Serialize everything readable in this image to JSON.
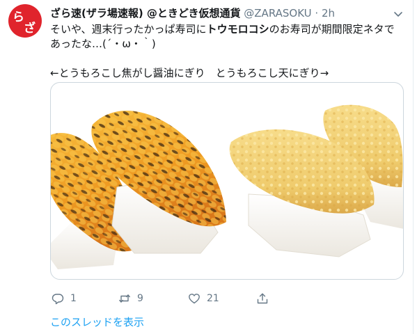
{
  "author": {
    "avatar_text_1": "ら",
    "avatar_text_2": "ざ",
    "display_name": "ざら速(ザラ場速報) @ときどき仮想通貨",
    "handle": "@ZARASOKU",
    "separator": "·",
    "time": "2h"
  },
  "tweet": {
    "line1_pre": "そいや、週末行ったかっぱ寿司に",
    "line1_bold": "トウモロコシ",
    "line1_post": "のお寿司が期間限定ネタで",
    "line2": "あったな…(´・ω・｀)",
    "line3": "←とうもろこし焦がし醤油にぎり　とうもろこし天にぎり→"
  },
  "actions": {
    "reply_count": "1",
    "retweet_count": "9",
    "like_count": "21"
  },
  "thread_link": "このスレッドを表示",
  "icons": [
    "chevron-down-icon",
    "reply-icon",
    "retweet-icon",
    "heart-icon",
    "share-icon"
  ],
  "colors": {
    "text": "#14171a",
    "secondary": "#657786",
    "link": "#1da1f2",
    "avatar": "#e0242c",
    "border": "#ccd6dd"
  }
}
